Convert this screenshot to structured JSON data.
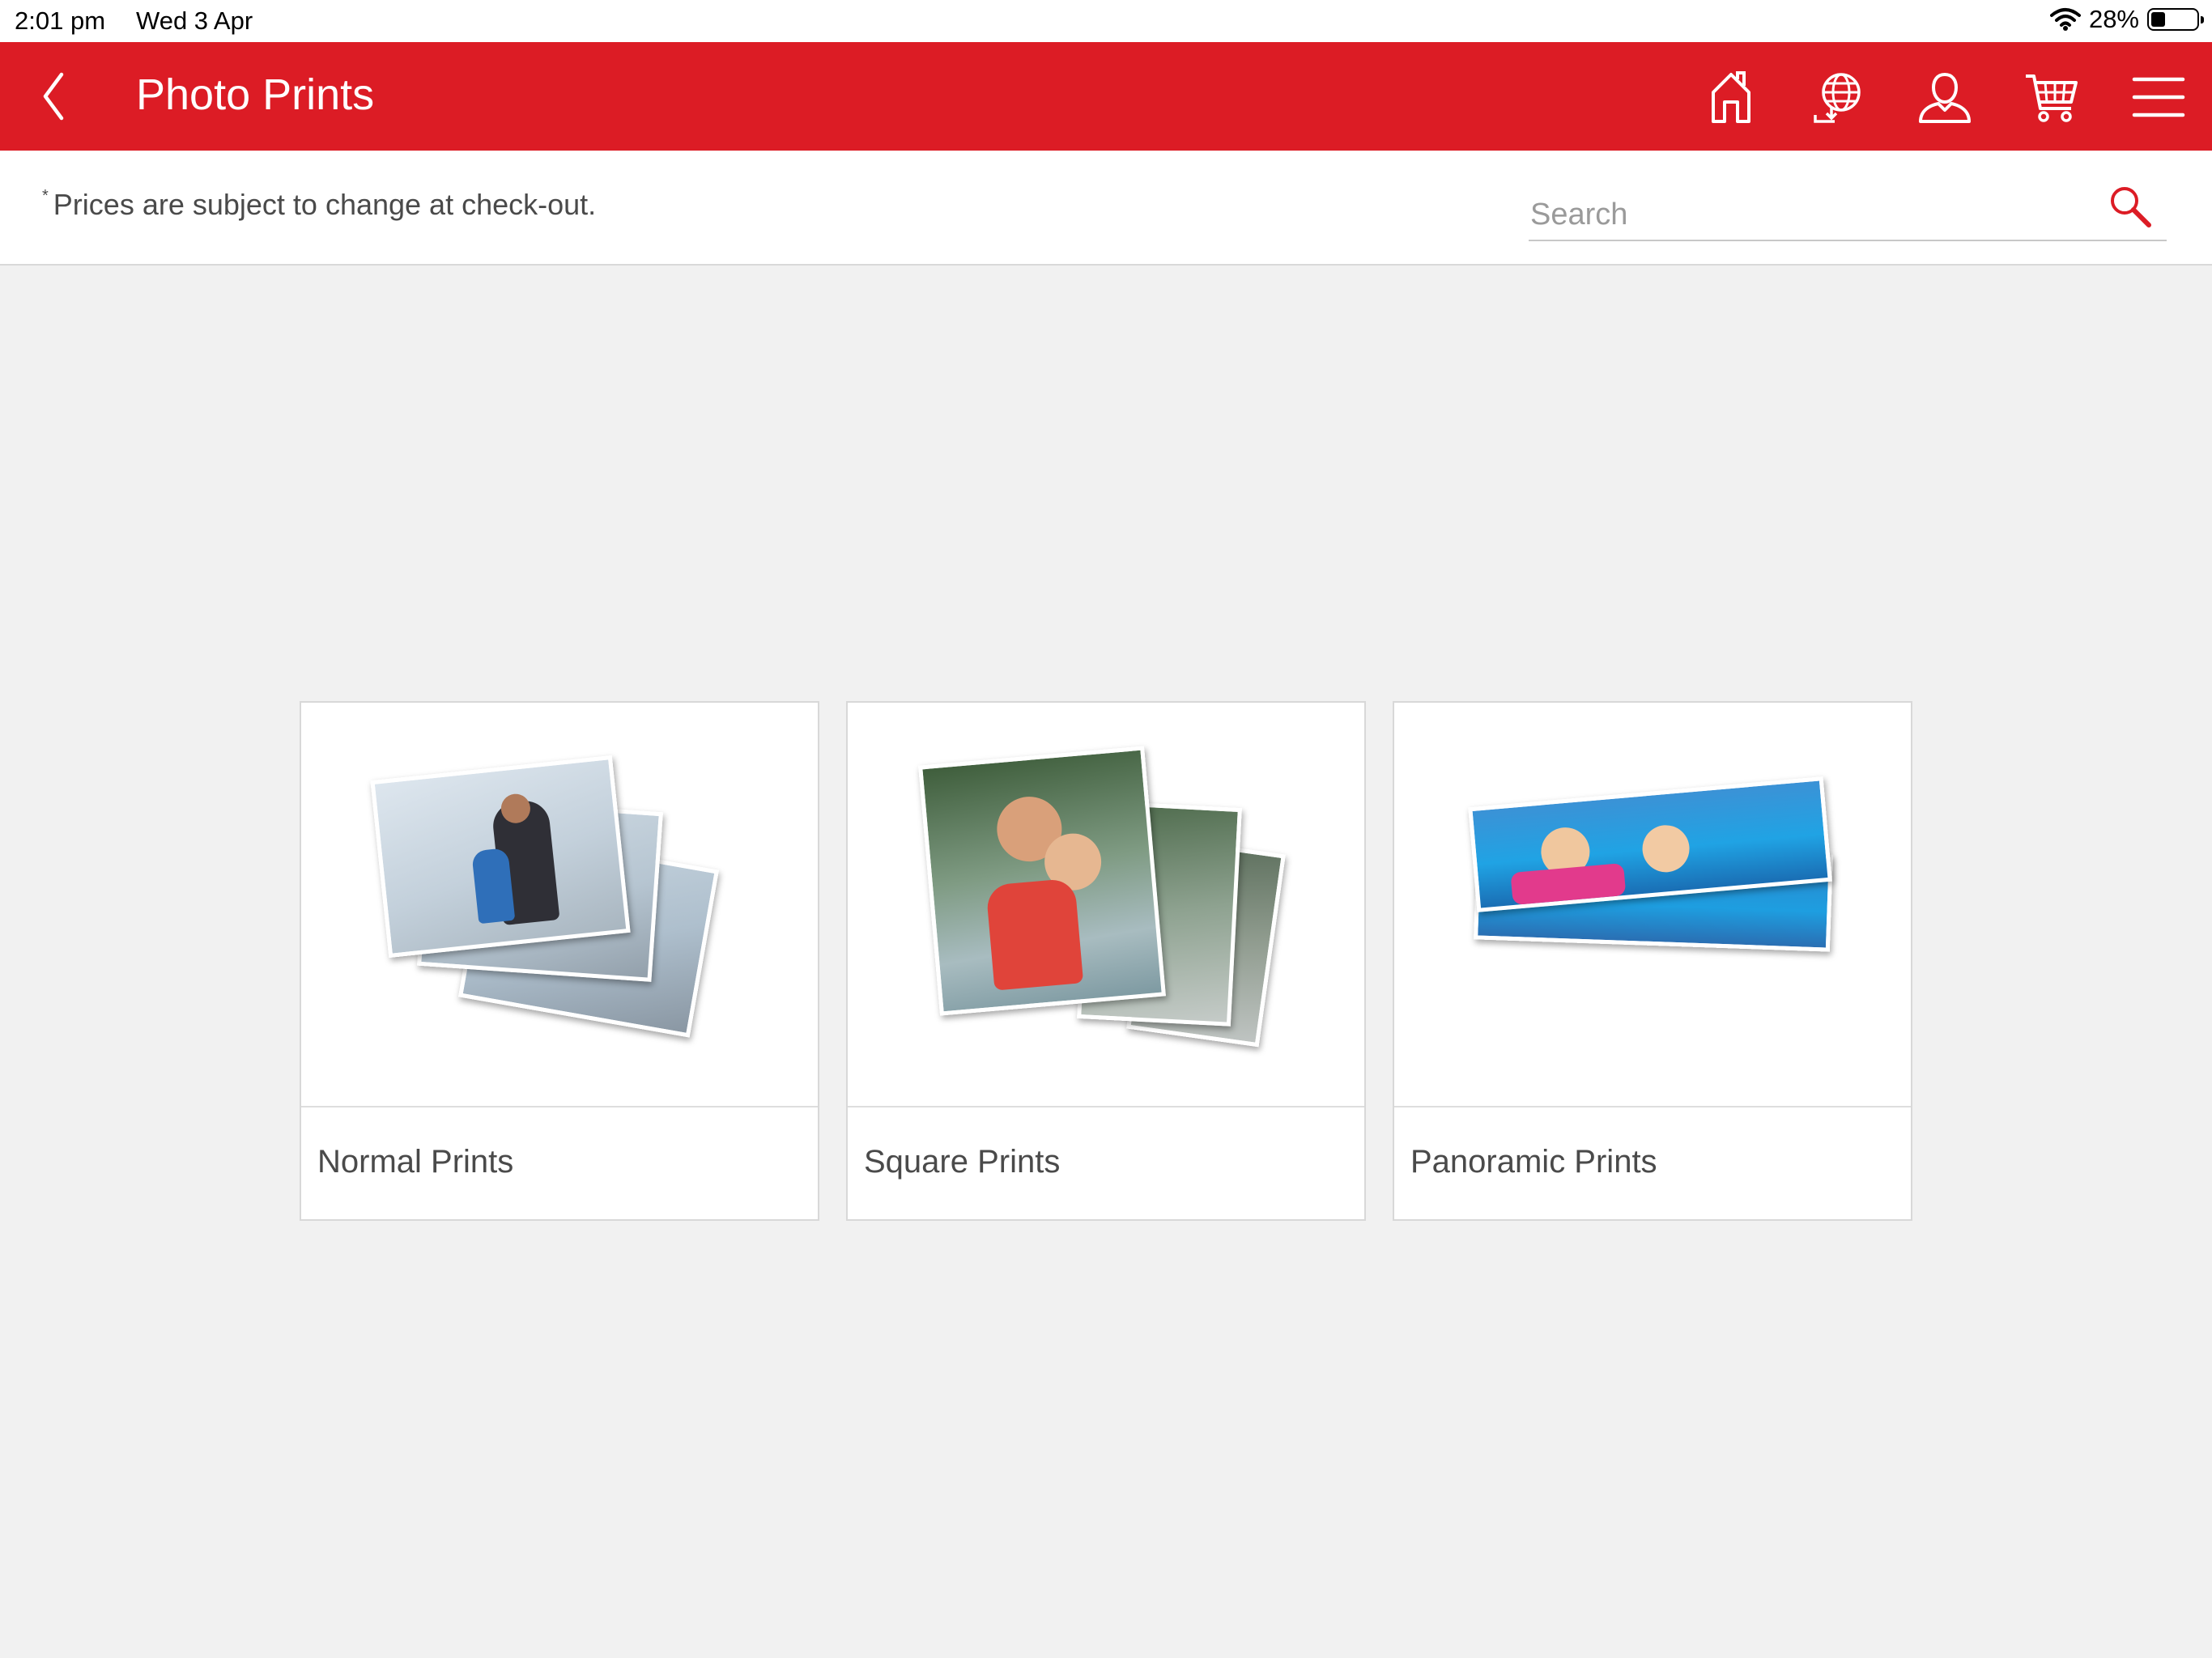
{
  "status_bar": {
    "time": "2:01 pm",
    "date": "Wed 3 Apr",
    "battery": "28%",
    "battery_level": 0.28
  },
  "header": {
    "title": "Photo Prints",
    "icons": [
      "back-icon",
      "home-icon",
      "globe-icon",
      "account-icon",
      "cart-icon",
      "menu-icon"
    ]
  },
  "subbar": {
    "notice_mark": "*",
    "notice": "Prices are subject to change at check-out.",
    "search_placeholder": "Search"
  },
  "products": [
    {
      "label": "Normal Prints"
    },
    {
      "label": "Square Prints"
    },
    {
      "label": "Panoramic Prints"
    }
  ],
  "colors": {
    "brand_red": "#dc1c25",
    "background": "#f1f1f1"
  }
}
